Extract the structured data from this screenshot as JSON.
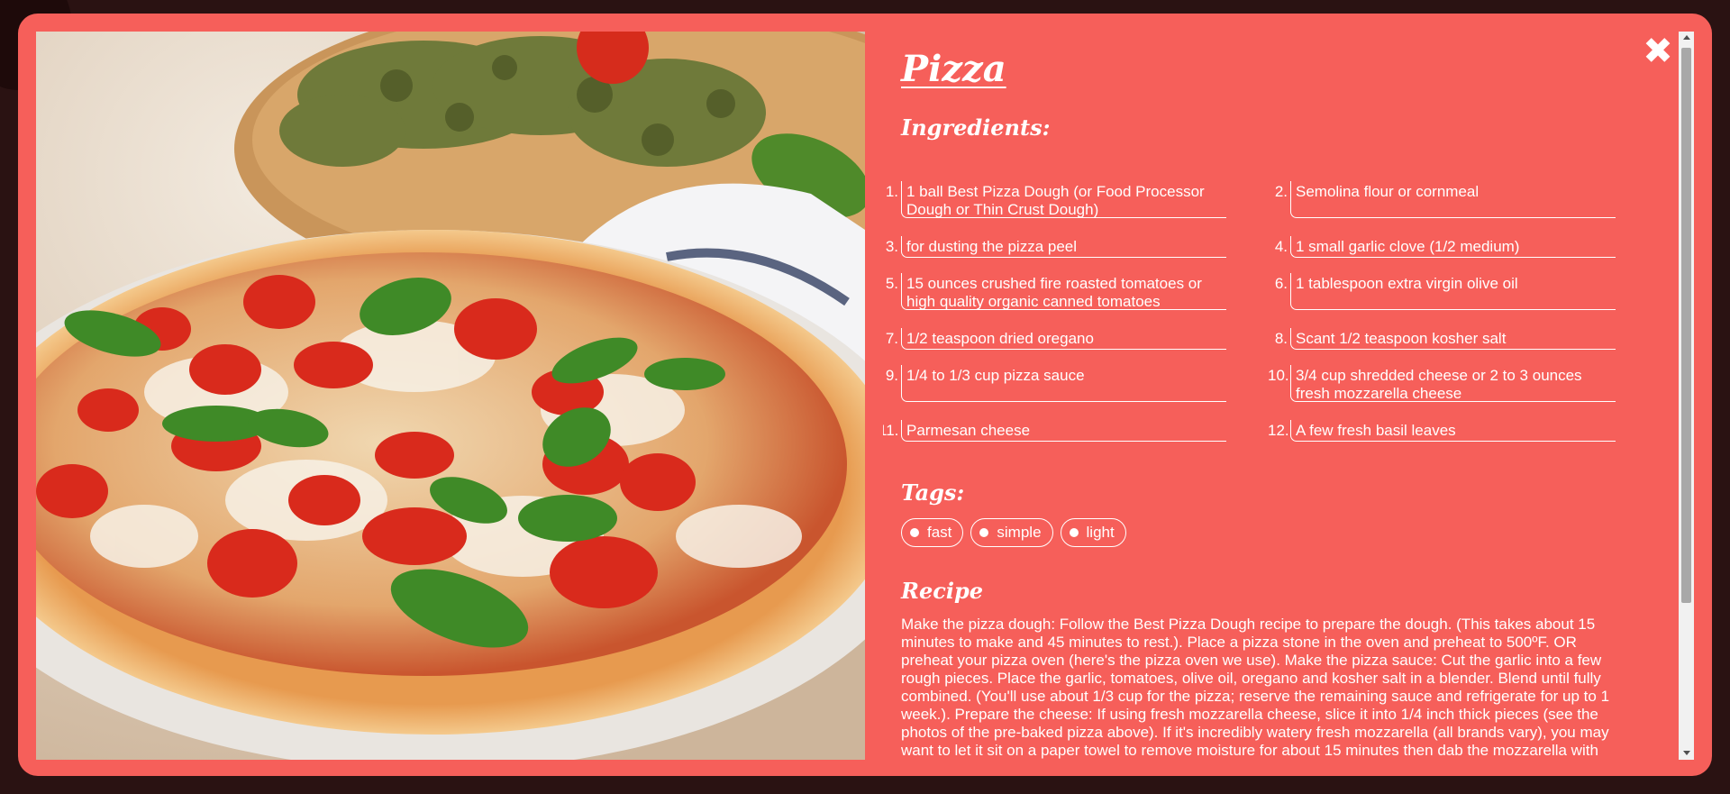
{
  "modal": {
    "title": "Pizza",
    "image_alt": "Pizza with tomatoes, mozzarella and basil",
    "close_icon": "close-icon",
    "close_glyph": "✖"
  },
  "sections": {
    "ingredients_heading": "Ingredients:",
    "tags_heading": "Tags:",
    "recipe_heading": "Recipe"
  },
  "ingredients": [
    {
      "num": "1.",
      "text": "1 ball Best Pizza Dough (or Food Processor Dough or Thin Crust Dough)"
    },
    {
      "num": "2.",
      "text": "Semolina flour or cornmeal"
    },
    {
      "num": "3.",
      "text": "for dusting the pizza peel"
    },
    {
      "num": "4.",
      "text": "1 small garlic clove (1/2 medium)"
    },
    {
      "num": "5.",
      "text": "15 ounces crushed fire roasted tomatoes or high quality organic canned tomatoes"
    },
    {
      "num": "6.",
      "text": "1 tablespoon extra virgin olive oil"
    },
    {
      "num": "7.",
      "text": "1/2 teaspoon dried oregano"
    },
    {
      "num": "8.",
      "text": "Scant 1/2 teaspoon kosher salt"
    },
    {
      "num": "9.",
      "text": "1/4 to 1/3 cup pizza sauce"
    },
    {
      "num": "10.",
      "text": "3/4 cup shredded cheese or 2 to 3 ounces fresh mozzarella cheese"
    },
    {
      "num": "11.",
      "text": "Parmesan cheese"
    },
    {
      "num": "12.",
      "text": "A few fresh basil leaves"
    }
  ],
  "tags": [
    "fast",
    "simple",
    "light"
  ],
  "recipe_text": "Make the pizza dough: Follow the Best Pizza Dough recipe to prepare the dough. (This takes about 15 minutes to make and 45 minutes to rest.). Place a pizza stone in the oven and preheat to 500ºF. OR preheat your pizza oven (here's the pizza oven we use). Make the pizza sauce: Cut the garlic into a few rough pieces. Place the garlic, tomatoes, olive oil, oregano and kosher salt in a blender. Blend until fully combined. (You'll use about 1/3 cup for the pizza; reserve the remaining sauce and refrigerate for up to 1 week.). Prepare the cheese: If using fresh mozzarella cheese, slice it into 1/4 inch thick pieces (see the photos of the pre-baked pizza above). If it's incredibly watery fresh mozzarella (all brands vary), you may want to let it sit on a paper towel to remove moisture for about 15 minutes then dab the mozzarella with the paper towel to remove",
  "colors": {
    "modal_bg": "#f65f5a",
    "backdrop": "#2a1212",
    "text": "#ffffff"
  }
}
